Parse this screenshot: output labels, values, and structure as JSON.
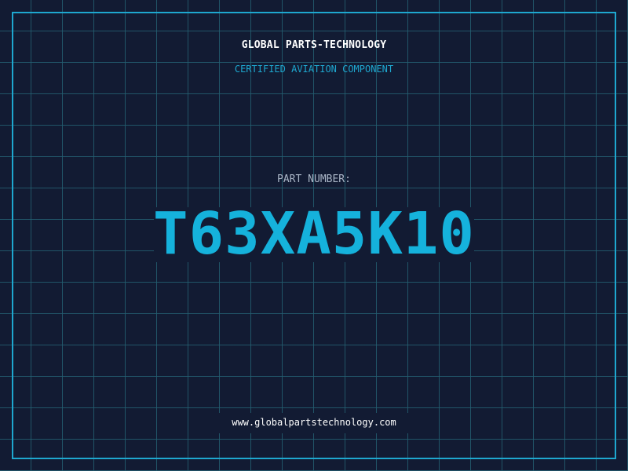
{
  "brand": {
    "title": "GLOBAL PARTS-TECHNOLOGY",
    "subtitle": "CERTIFIED AVIATION COMPONENT"
  },
  "part": {
    "label": "PART NUMBER:",
    "number": "T63XA5K10"
  },
  "footer": {
    "url": "www.globalpartstechnology.com"
  },
  "colors": {
    "background": "#121b33",
    "grid": "#235e70",
    "accent": "#1ea7cf",
    "part_number": "#15b2dc",
    "label": "#a9b5c6",
    "text": "#ffffff"
  }
}
